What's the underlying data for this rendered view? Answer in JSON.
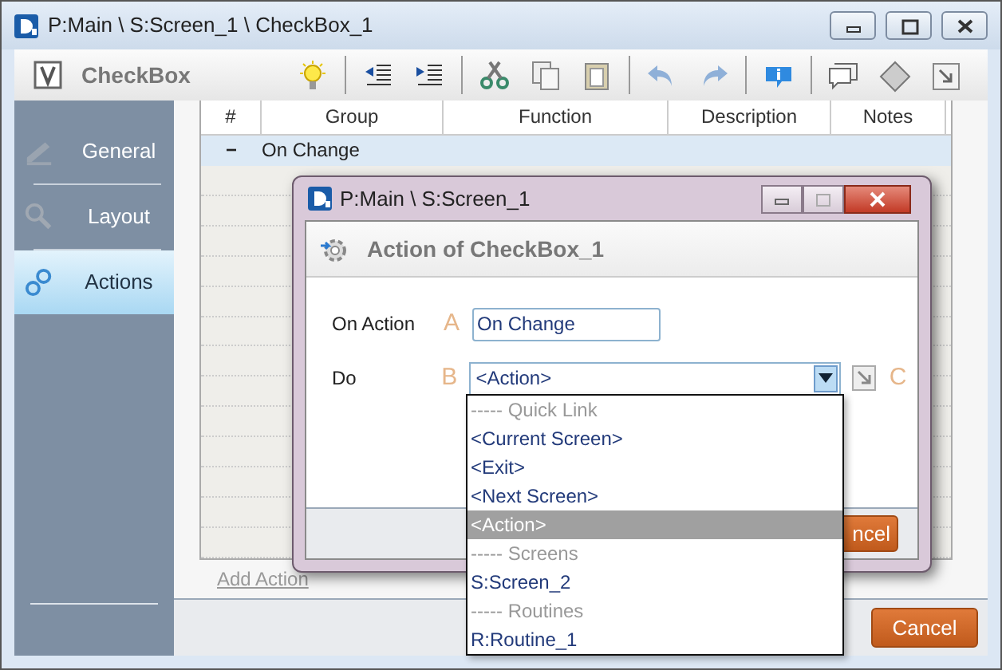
{
  "window": {
    "title": "P:Main \\ S:Screen_1 \\ CheckBox_1"
  },
  "toolbar": {
    "title": "CheckBox"
  },
  "sidebar": {
    "items": [
      {
        "label": "General",
        "selected": false
      },
      {
        "label": "Layout",
        "selected": false
      },
      {
        "label": "Actions",
        "selected": true
      }
    ]
  },
  "table": {
    "columns": [
      "#",
      "Group",
      "Function",
      "Description",
      "Notes"
    ],
    "rows": [
      {
        "toggle": "−",
        "label": "On Change"
      }
    ]
  },
  "add_action": "Add Action",
  "buttons": [
    {
      "label": "Cancel"
    }
  ],
  "dialog": {
    "title": "P:Main \\ S:Screen_1",
    "heading": "Action of CheckBox_1",
    "fields": [
      {
        "label": "On Action",
        "marker": "A",
        "value": "On Change",
        "kind": "text"
      },
      {
        "label": "Do",
        "marker": "B",
        "value": "<Action>",
        "kind": "select"
      }
    ],
    "side_marker": "C",
    "button": "ncel"
  },
  "dropdown": {
    "items": [
      {
        "kind": "header",
        "label": "----- Quick Link",
        "selected": false
      },
      {
        "kind": "option",
        "label": "<Current Screen>",
        "selected": false
      },
      {
        "kind": "option",
        "label": "<Exit>",
        "selected": false
      },
      {
        "kind": "option",
        "label": "<Next Screen>",
        "selected": false
      },
      {
        "kind": "option",
        "label": "<Action>",
        "selected": true
      },
      {
        "kind": "header",
        "label": "----- Screens",
        "selected": false
      },
      {
        "kind": "option",
        "label": "S:Screen_2",
        "selected": false
      },
      {
        "kind": "header",
        "label": "----- Routines",
        "selected": false
      },
      {
        "kind": "option",
        "label": "R:Routine_1",
        "selected": false
      }
    ]
  }
}
